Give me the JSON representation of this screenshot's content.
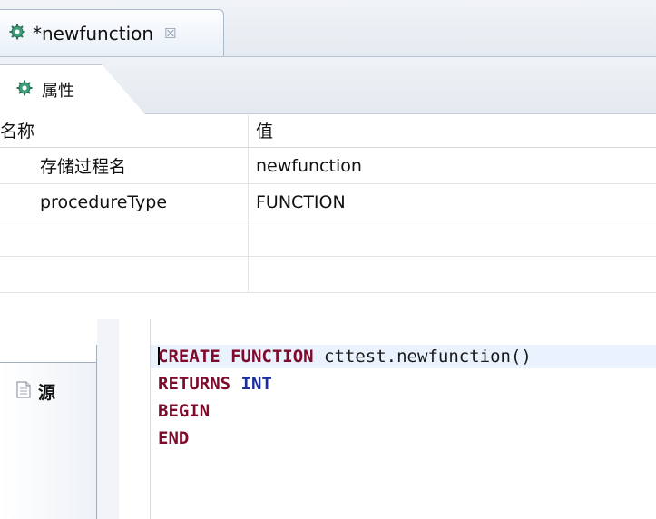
{
  "editor_tab": {
    "title": "*newfunction",
    "close_symbol": "☒",
    "icon": "gear-icon"
  },
  "properties_tab": {
    "label": "属性",
    "icon": "gear-icon"
  },
  "properties_table": {
    "headers": {
      "name": "名称",
      "value": "值"
    },
    "rows": [
      {
        "name": "存储过程名",
        "value": "newfunction"
      },
      {
        "name": "procedureType",
        "value": "FUNCTION"
      },
      {
        "name": "",
        "value": ""
      },
      {
        "name": "",
        "value": ""
      }
    ]
  },
  "source_tab": {
    "label": "源",
    "icon": "document-icon"
  },
  "code": {
    "line1": {
      "kw1": "CREATE",
      "kw2": "FUNCTION",
      "rest": " cttest.newfunction()"
    },
    "line2": {
      "kw1": "RETURNS",
      "kw2": "INT"
    },
    "line3": {
      "kw1": "BEGIN"
    },
    "line4": {
      "kw1": "END"
    }
  },
  "colors": {
    "keyword": "#7f0b2c",
    "type_keyword": "#1c2e9c",
    "current_line": "#eaf2fd"
  }
}
